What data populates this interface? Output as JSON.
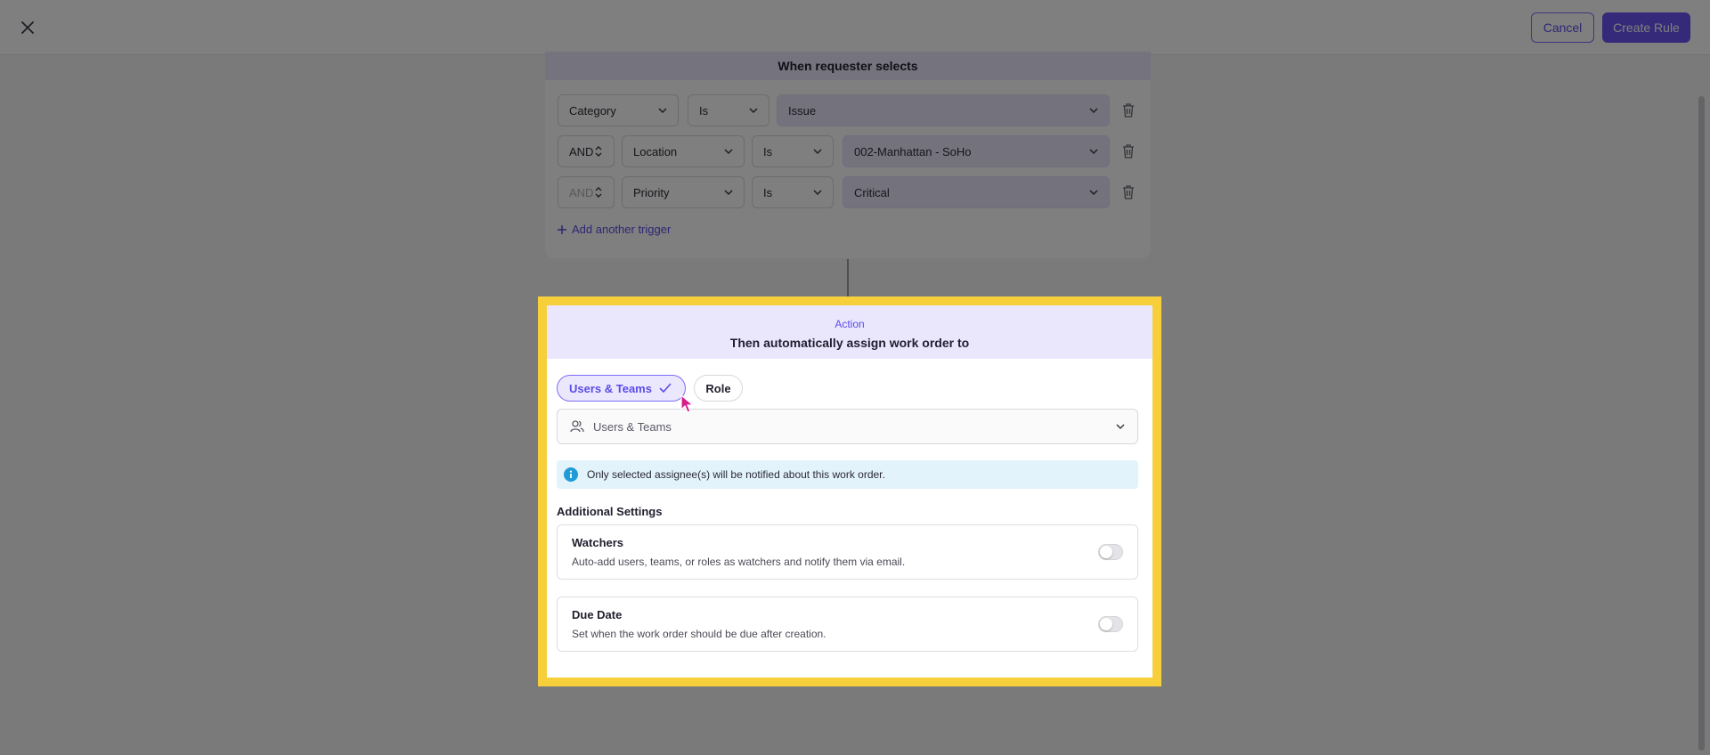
{
  "topbar": {
    "cancel_label": "Cancel",
    "create_label": "Create Rule"
  },
  "trigger": {
    "header": "When requester selects",
    "rows": [
      {
        "connector": "",
        "field": "Category",
        "operator": "Is",
        "value": "Issue"
      },
      {
        "connector": "AND",
        "field": "Location",
        "operator": "Is",
        "value": "002-Manhattan - SoHo"
      },
      {
        "connector": "AND",
        "field": "Priority",
        "operator": "Is",
        "value": "Critical"
      }
    ],
    "add_label": "Add another trigger"
  },
  "action": {
    "eyebrow": "Action",
    "title": "Then automatically assign work order to",
    "tabs": [
      {
        "label": "Users & Teams",
        "selected": true
      },
      {
        "label": "Role",
        "selected": false
      }
    ],
    "assignee_placeholder": "Users & Teams",
    "info_text": "Only selected assignee(s) will be notified about this work order.",
    "additional_title": "Additional Settings",
    "settings": [
      {
        "title": "Watchers",
        "description": "Auto-add users, teams, or roles as watchers and notify them via email.",
        "enabled": false
      },
      {
        "title": "Due Date",
        "description": "Set when the work order should be due after creation.",
        "enabled": false
      }
    ]
  },
  "icons": {
    "close": "close-icon",
    "chevron": "chevron-down-icon",
    "stepper": "stepper-icon",
    "trash": "trash-icon",
    "plus": "plus-icon",
    "check": "check-icon",
    "users": "users-icon",
    "info": "info-icon",
    "cursor": "mouse-pointer-icon"
  },
  "colors": {
    "accent": "#6a55f2",
    "highlight_border": "#f7cf3a",
    "header_bg": "#eae7fd",
    "info_bg": "#e3f3fb",
    "info_icon": "#1f9bd8"
  }
}
